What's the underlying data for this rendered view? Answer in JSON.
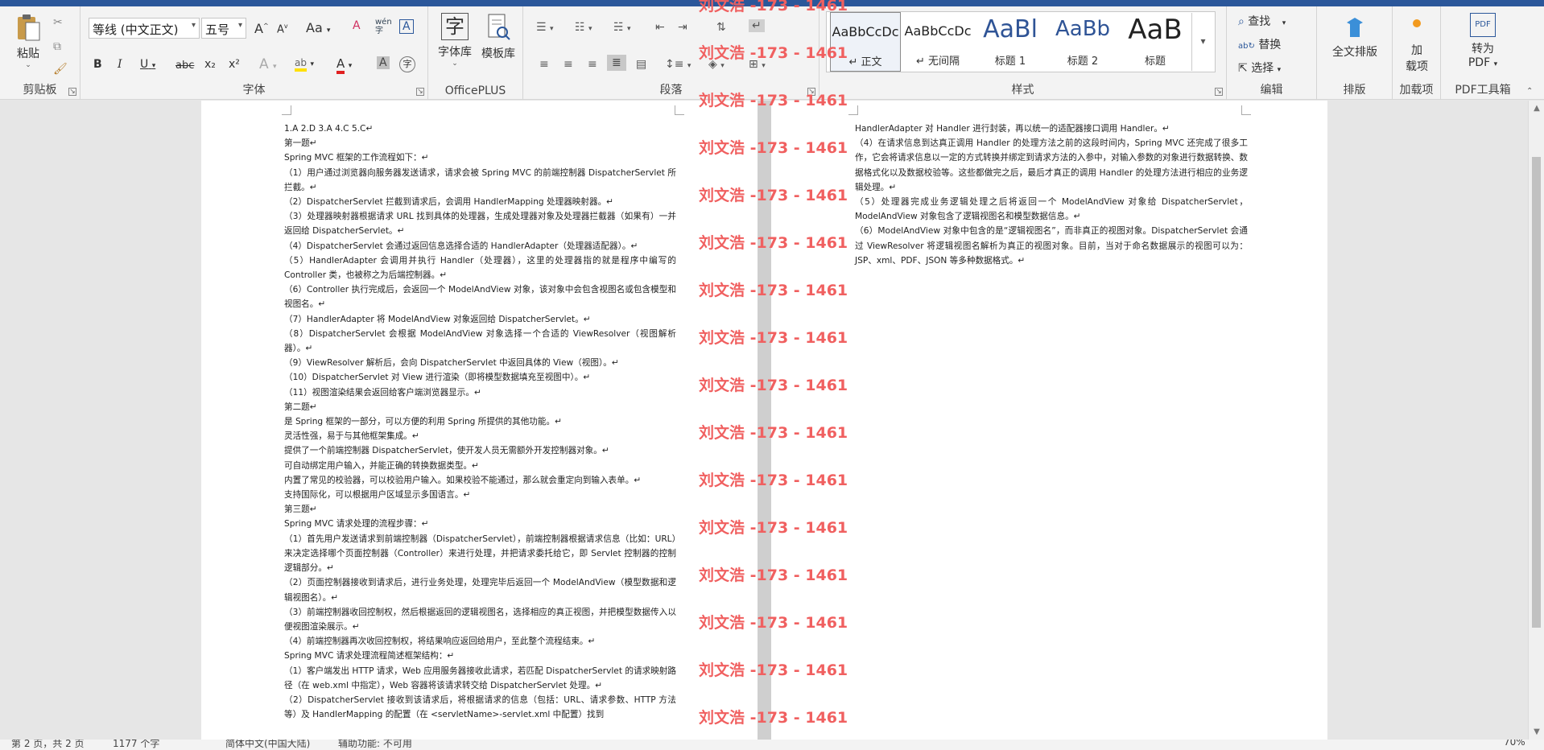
{
  "ribbon": {
    "clipboard": {
      "group_label": "剪贴板",
      "paste_label": "粘贴"
    },
    "font": {
      "group_label": "字体",
      "font_name": "等线 (中文正文)",
      "font_size": "五号",
      "bold": "B",
      "italic": "I",
      "underline": "U",
      "strike": "abc",
      "subscript": "x₂",
      "superscript": "x²",
      "change_case": "Aa",
      "grow": "A",
      "shrink": "A",
      "phonetic": "wén",
      "clear_format": "A",
      "border_char": "A",
      "text_effect": "A",
      "highlight": "ab",
      "font_color": "A",
      "shading": "A",
      "enclose": "字"
    },
    "officeplus": {
      "group_label": "OfficePLUS",
      "font_lib_label": "字体库",
      "template_lib_label": "模板库",
      "font_lib_glyph": "字"
    },
    "paragraph": {
      "group_label": "段落"
    },
    "styles": {
      "group_label": "样式",
      "items": [
        {
          "preview": "AaBbCcDc",
          "name": "↵ 正文"
        },
        {
          "preview": "AaBbCcDc",
          "name": "↵ 无间隔"
        },
        {
          "preview": "AaBl",
          "name": "标题 1"
        },
        {
          "preview": "AaBb",
          "name": "标题 2"
        },
        {
          "preview": "AaB",
          "name": "标题"
        }
      ]
    },
    "editing": {
      "group_label": "编辑",
      "find_label": "查找",
      "replace_label": "替换",
      "select_label": "选择"
    },
    "layout": {
      "group_label": "排版",
      "full_layout_label": "全文排版"
    },
    "addins": {
      "group_label": "加载项",
      "addin_label_1": "加",
      "addin_label_2": "载项"
    },
    "pdf": {
      "group_label": "PDF工具箱",
      "convert_label_1": "转为",
      "convert_label_2": "PDF",
      "icon_text": "PDF"
    }
  },
  "watermark": {
    "text": "刘文浩 -173 - 1461"
  },
  "page_left": {
    "lines": [
      "1.A   2.D  3.A   4.C   5.C↵",
      "第一题↵",
      "Spring MVC 框架的工作流程如下：↵",
      "（1）用户通过浏览器向服务器发送请求，请求会被 Spring MVC 的前端控制器 DispatcherServlet 所拦截。↵",
      "（2）DispatcherServlet 拦截到请求后，会调用 HandlerMapping 处理器映射器。↵",
      "（3）处理器映射器根据请求 URL 找到具体的处理器，生成处理器对象及处理器拦截器（如果有）一并返回给 DispatcherServlet。↵",
      "（4）DispatcherServlet 会通过返回信息选择合适的 HandlerAdapter（处理器适配器）。↵",
      "（5）HandlerAdapter 会调用并执行 Handler（处理器），这里的处理器指的就是程序中编写的 Controller 类，也被称之为后端控制器。↵",
      "（6）Controller 执行完成后，会返回一个 ModelAndView 对象，该对象中会包含视图名或包含模型和视图名。↵",
      "（7）HandlerAdapter 将 ModelAndView 对象返回给 DispatcherServlet。↵",
      "（8）DispatcherServlet 会根据 ModelAndView 对象选择一个合适的 ViewResolver（视图解析器）。↵",
      "（9）ViewResolver 解析后，会向 DispatcherServlet 中返回具体的 View（视图）。↵",
      "（10）DispatcherServlet 对 View 进行渲染（即将模型数据填充至视图中）。↵",
      "（11）视图渲染结果会返回给客户端浏览器显示。↵",
      "第二题↵",
      "是 Spring 框架的一部分，可以方便的利用 Spring 所提供的其他功能。↵",
      "灵活性强，易于与其他框架集成。↵",
      "提供了一个前端控制器 DispatcherServlet，使开发人员无需额外开发控制器对象。↵",
      "可自动绑定用户输入，并能正确的转换数据类型。↵",
      "内置了常见的校验器，可以校验用户输入。如果校验不能通过，那么就会重定向到输入表单。↵",
      "支持国际化，可以根据用户区域显示多国语言。↵",
      "第三题↵",
      "Spring MVC 请求处理的流程步骤：↵",
      "（1）首先用户发送请求到前端控制器（DispatcherServlet），前端控制器根据请求信息（比如：URL）来决定选择哪个页面控制器（Controller）来进行处理，并把请求委托给它，即 Servlet 控制器的控制逻辑部分。↵",
      "（2）页面控制器接收到请求后，进行业务处理，处理完毕后返回一个 ModelAndView（模型数据和逻辑视图名）。↵",
      "（3）前端控制器收回控制权，然后根据返回的逻辑视图名，选择相应的真正视图，并把模型数据传入以便视图渲染展示。↵",
      "（4）前端控制器再次收回控制权，将结果响应返回给用户，至此整个流程结束。↵",
      "Spring MVC 请求处理流程简述框架结构：↵",
      "（1）客户端发出 HTTP 请求，Web 应用服务器接收此请求，若匹配 DispatcherServlet 的请求映射路径（在 web.xml 中指定），Web 容器将该请求转交给 DispatcherServlet 处理。↵",
      "（2）DispatcherServlet 接收到该请求后，将根据请求的信息（包括：URL、请求参数、HTTP 方法等）及 HandlerMapping 的配置（在 <servletName>-servlet.xml 中配置）找到"
    ]
  },
  "page_right": {
    "lines": [
      "HandlerAdapter 对 Handler 进行封装，再以统一的适配器接口调用 Handler。↵",
      "（4）在请求信息到达真正调用 Handler 的处理方法之前的这段时间内，Spring MVC 还完成了很多工作，它会将请求信息以一定的方式转换并绑定到请求方法的入参中，对输入参数的对象进行数据转换、数据格式化以及数据校验等。这些都做完之后，最后才真正的调用 Handler 的处理方法进行相应的业务逻辑处理。↵",
      "（5）处理器完成业务逻辑处理之后将返回一个 ModelAndView 对象给 DispatcherServlet，ModelAndView 对象包含了逻辑视图名和模型数据信息。↵",
      "（6）ModelAndView 对象中包含的是“逻辑视图名”，而非真正的视图对象。DispatcherServlet 会通过 ViewResolver 将逻辑视图名解析为真正的视图对象。目前，当对于命名数据展示的视图可以为：JSP、xml、PDF、JSON 等多种数据格式。↵"
    ]
  },
  "statusbar": {
    "page_info": "第 2 页，共 2 页",
    "word_count": "1177 个字",
    "language": "简体中文(中国大陆)",
    "accessibility": "辅助功能: 不可用",
    "zoom": "70%"
  },
  "icons": [
    "paste-icon",
    "cut-icon",
    "copy-icon",
    "format-painter-icon",
    "find-icon",
    "replace-icon",
    "select-icon",
    "full-layout-icon",
    "addin-icon",
    "pdf-icon"
  ]
}
